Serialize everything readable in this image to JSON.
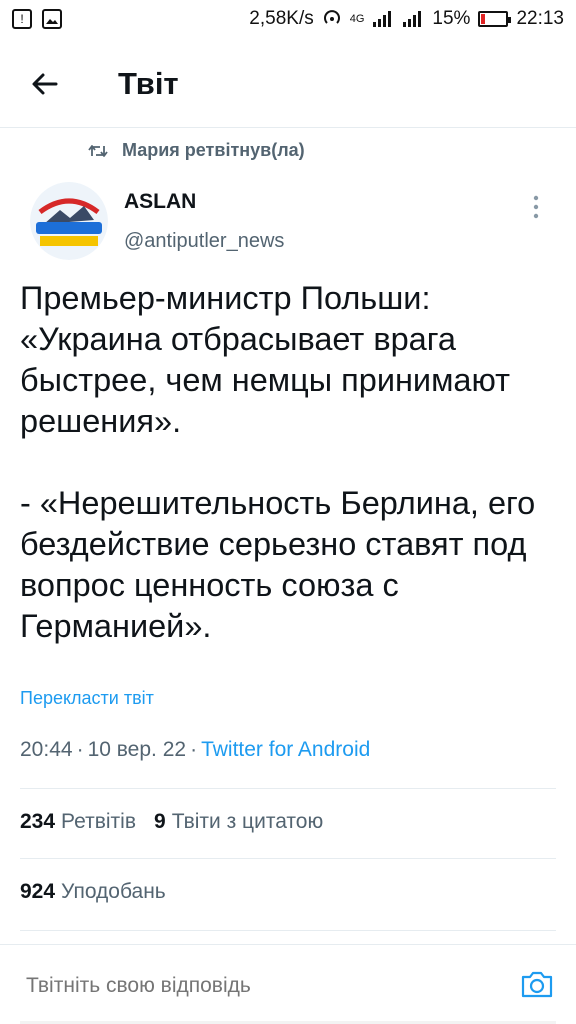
{
  "status_bar": {
    "speed": "2,58K/s",
    "network": "4G",
    "battery": "15%",
    "battery_level": 0.15,
    "time": "22:13"
  },
  "header": {
    "title": "Твіт"
  },
  "tweet": {
    "retweet_context": "Мария ретвітнув(ла)",
    "author_name": "ASLAN",
    "author_handle": "@antiputler_news",
    "text": "Премьер-министр Польши: «Украина отбрасывает врага быстрее, чем немцы принимают решения».\n\n- «Нерешительность Берлина, его бездействие серьезно ставят под вопрос ценность союза с Германией».",
    "translate_label": "Перекласти твіт",
    "time": "20:44",
    "date": "10 вер. 22",
    "source": "Twitter for Android",
    "separator": "·"
  },
  "stats": {
    "retweets_count": "234",
    "retweets_label": "Ретвітів",
    "quotes_count": "9",
    "quotes_label": "Твіти з цитатою",
    "likes_count": "924",
    "likes_label": "Уподобань"
  },
  "reply": {
    "placeholder": "Твітніть свою відповідь"
  },
  "colors": {
    "accent": "#1d9bf0",
    "secondary_text": "#536471",
    "divider": "#e6ecf0"
  }
}
